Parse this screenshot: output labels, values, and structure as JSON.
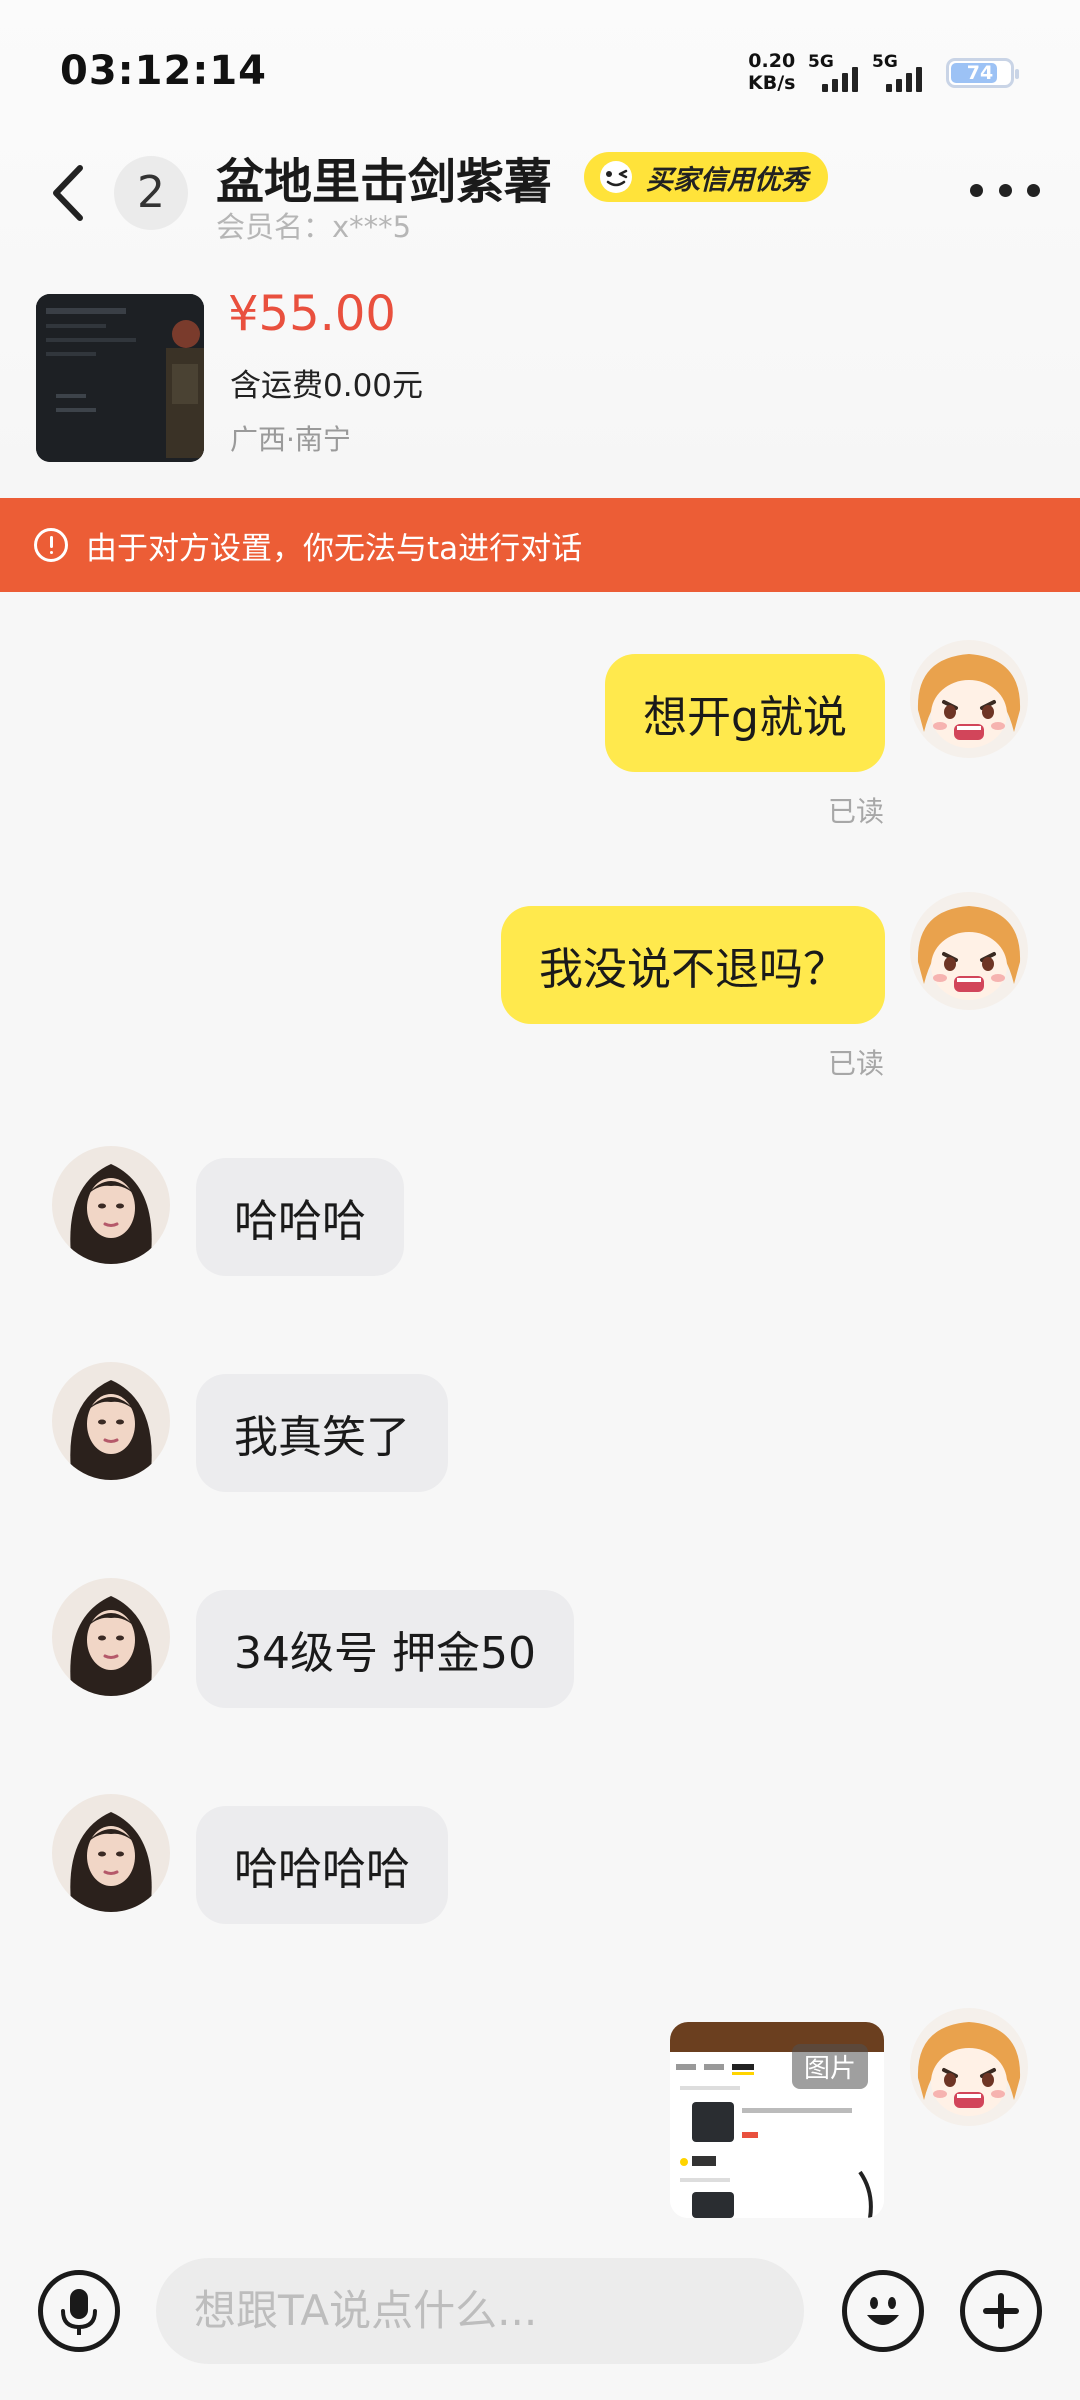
{
  "status_bar": {
    "time": "03:12:14",
    "net_speed_value": "0.20",
    "net_speed_unit": "KB/s",
    "sim1": "5G",
    "sim2": "5G",
    "battery": "74",
    "battery_level": 0.74
  },
  "header": {
    "unread_count": "2",
    "nickname": "盆地里击剑紫薯",
    "credit_badge": "买家信用优秀",
    "member_name": "会员名：x***5"
  },
  "product": {
    "price": "¥55.00",
    "shipping": "含运费0.00元",
    "location": "广西·南宁"
  },
  "banner": {
    "text": "由于对方设置，你无法与ta进行对话",
    "color": "#ec5d36"
  },
  "messages": [
    {
      "side": "me",
      "text": "想开g就说",
      "status": "已读"
    },
    {
      "side": "me",
      "text": "我没说不退吗？",
      "status": "已读"
    },
    {
      "side": "them",
      "text": "哈哈哈"
    },
    {
      "side": "them",
      "text": "我真笑了"
    },
    {
      "side": "them",
      "text": "34级号 押金50"
    },
    {
      "side": "them",
      "text": "哈哈哈哈"
    },
    {
      "side": "me",
      "type": "image",
      "label": "图片"
    }
  ],
  "input": {
    "placeholder": "想跟TA说点什么..."
  },
  "colors": {
    "my_bubble": "#ffe94d",
    "their_bubble": "#ececee",
    "price": "#e9503e",
    "credit_badge": "#ffe33a"
  }
}
